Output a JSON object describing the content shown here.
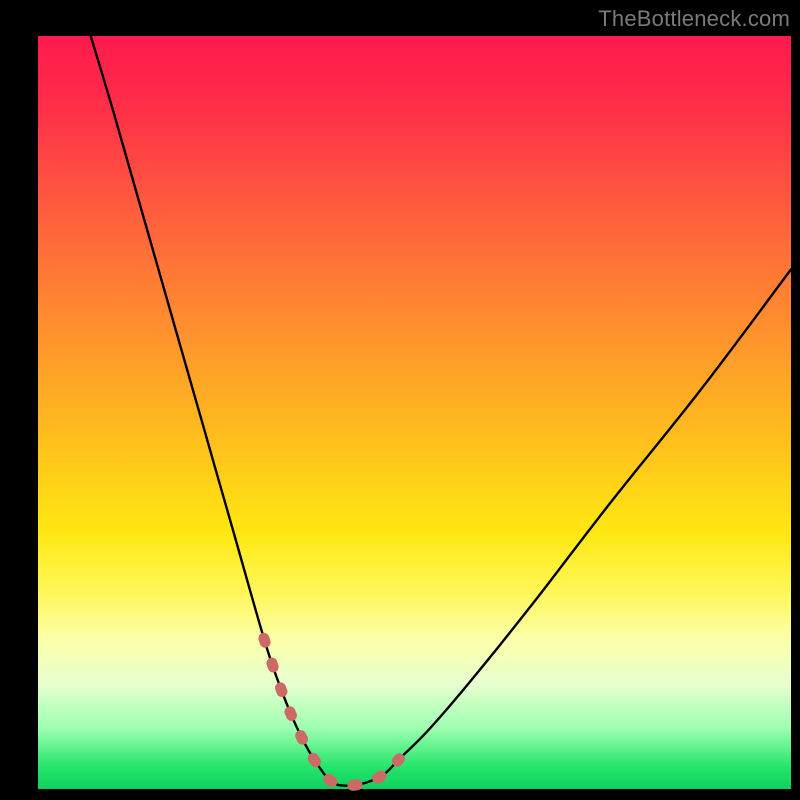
{
  "watermark": "TheBottleneck.com",
  "colors": {
    "frame": "#000000",
    "curve": "#000000",
    "dash": "#cc6a66"
  },
  "chart_data": {
    "type": "line",
    "title": "",
    "xlabel": "",
    "ylabel": "",
    "xlim": [
      0,
      100
    ],
    "ylim": [
      0,
      100
    ],
    "grid": false,
    "legend": false,
    "series": [
      {
        "name": "bottleneck-curve",
        "x": [
          7,
          10,
          14,
          18,
          22,
          26,
          30,
          32,
          34,
          36,
          38,
          39,
          40,
          42,
          44,
          46,
          48,
          52,
          58,
          66,
          76,
          88,
          100
        ],
        "y": [
          100,
          90,
          76,
          62,
          48,
          34,
          20,
          14,
          9,
          5,
          2,
          1,
          0.5,
          0.5,
          1,
          2,
          4,
          8,
          15,
          25,
          38,
          53,
          69
        ]
      }
    ],
    "highlight_dash": {
      "name": "valley-markers",
      "x": [
        30,
        32,
        34,
        36,
        38,
        39,
        40,
        42,
        44,
        46,
        48
      ],
      "y": [
        20,
        14,
        9,
        5,
        2,
        1,
        0.5,
        0.5,
        1,
        2,
        4
      ]
    }
  }
}
